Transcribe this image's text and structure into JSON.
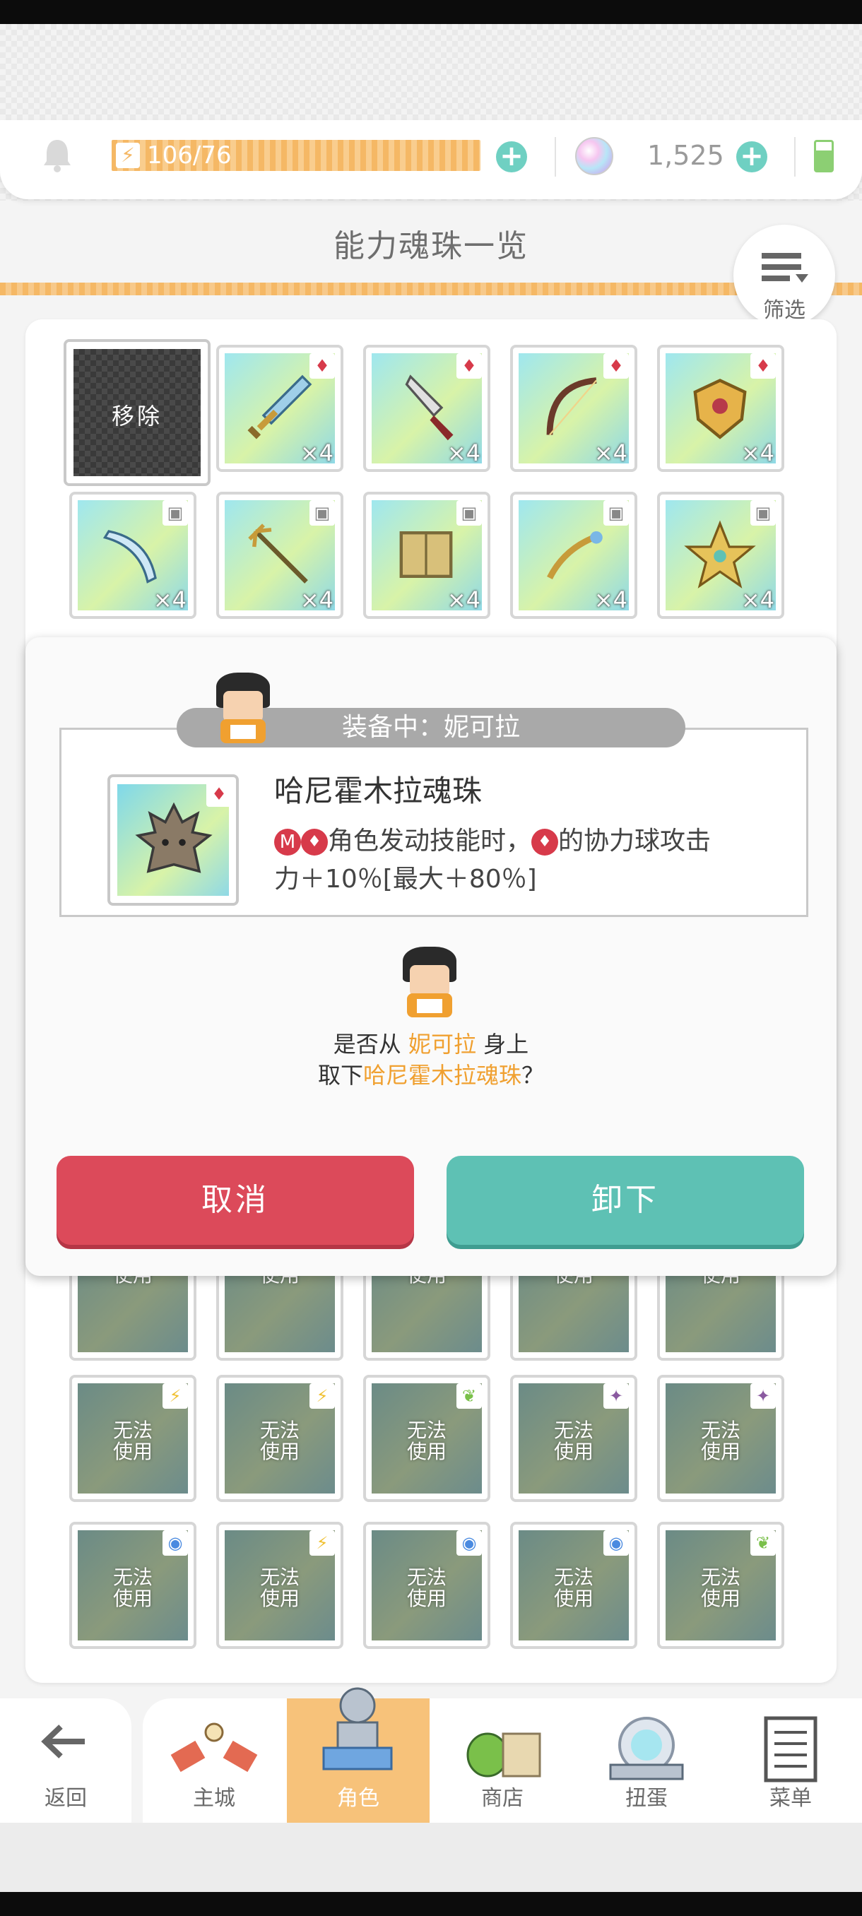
{
  "resources": {
    "stamina": "106/76",
    "gems": "1,525"
  },
  "page_title": "能力魂珠一览",
  "filter_label": "筛选",
  "grid": {
    "remove_label": "移除",
    "row1": [
      {
        "count": "×4",
        "tag": "♦"
      },
      {
        "count": "×4",
        "tag": "♦"
      },
      {
        "count": "×4",
        "tag": "♦"
      },
      {
        "count": "×4",
        "tag": "♦"
      }
    ],
    "row2": [
      {
        "count": "×4"
      },
      {
        "count": "×4"
      },
      {
        "count": "×4"
      },
      {
        "count": "×4"
      },
      {
        "count": "×4"
      }
    ],
    "unusable": "无法\n使用"
  },
  "modal": {
    "equipped_label": "装备中：妮可拉",
    "gem_name": "哈尼霍木拉魂珠",
    "gem_desc_1": "角色发动技能时，",
    "gem_desc_2": "的协力球攻击",
    "gem_desc_3": "力＋10％[最大＋80％]",
    "question_1a": "是否从 ",
    "question_1b": "妮可拉",
    "question_1c": " 身上",
    "question_2a": "取下",
    "question_2b": "哈尼霍木拉魂珠",
    "question_2c": "？",
    "cancel": "取消",
    "confirm": "卸下"
  },
  "nav": {
    "back": "返回",
    "main_city": "主城",
    "character": "角色",
    "shop": "商店",
    "gacha": "扭蛋",
    "menu": "菜单"
  },
  "colors": {
    "accent_orange": "#f5b865",
    "cancel_red": "#dc4a5a",
    "confirm_teal": "#5ec1b4",
    "highlight": "#f0a030"
  }
}
